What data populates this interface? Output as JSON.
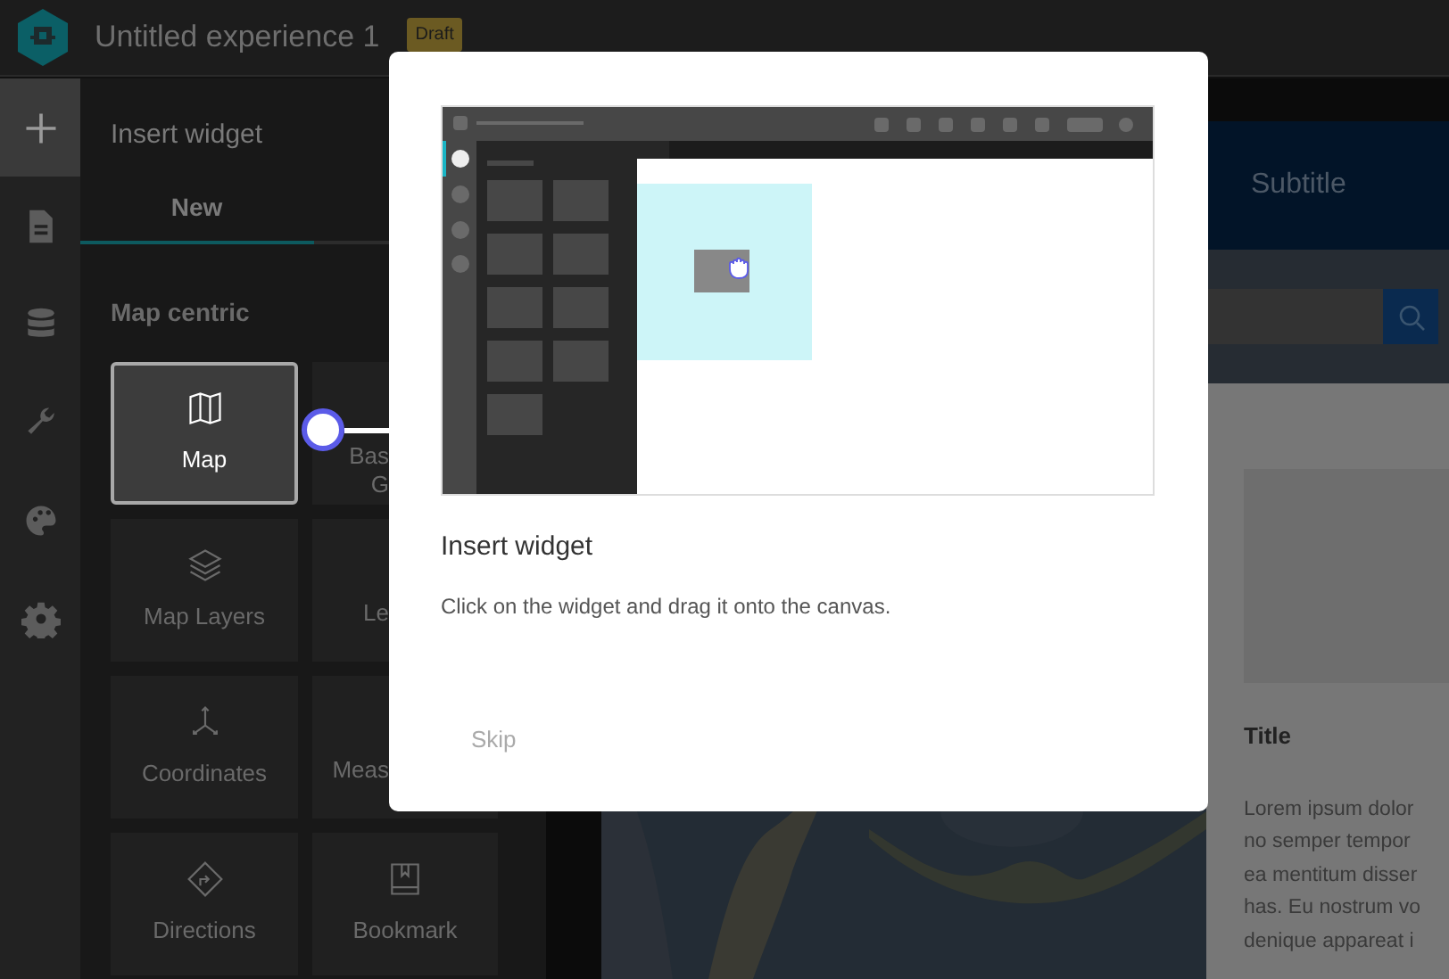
{
  "header": {
    "title": "Untitled experience 1",
    "badge": "Draft"
  },
  "rail": [
    {
      "selected": true
    },
    {
      "selected": false
    },
    {
      "selected": false
    },
    {
      "selected": false
    },
    {
      "selected": false
    },
    {
      "selected": false
    }
  ],
  "panel": {
    "title": "Insert widget",
    "tabs": [
      {
        "label": "New",
        "selected": true
      },
      {
        "selected": false
      }
    ],
    "section": "Map centric",
    "widgets": [
      {
        "kind": "full",
        "label": "Map",
        "selected": true
      },
      {
        "kind": "covered",
        "lines": [
          "Bas",
          "G"
        ],
        "selected": false
      },
      {
        "kind": "full",
        "label": "Map Layers",
        "selected": false
      },
      {
        "kind": "covered",
        "lines": [
          "Le"
        ],
        "selected": false
      },
      {
        "kind": "full",
        "label": "Coordinates",
        "selected": false
      },
      {
        "kind": "covered",
        "lines": [
          "Meas"
        ],
        "selected": false
      },
      {
        "kind": "full",
        "label": "Directions",
        "selected": false
      },
      {
        "kind": "full",
        "label": "Bookmark",
        "selected": false
      }
    ]
  },
  "canvas": {
    "subtitle": "Subtitle",
    "card_title": "Title",
    "card_text": [
      "Lorem ipsum dolor",
      "no semper tempor",
      "ea mentitum disser",
      "has. Eu nostrum vo",
      "denique appareat i"
    ]
  },
  "dialog": {
    "title": "Insert widget",
    "text": "Click on the widget and drag it onto the canvas.",
    "skip": "Skip"
  }
}
